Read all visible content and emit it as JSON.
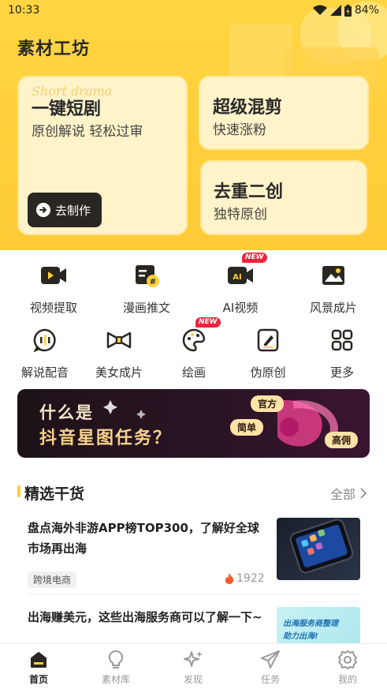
{
  "status": {
    "time": "10:33",
    "battery": "84%"
  },
  "header": {
    "title": "素材工坊"
  },
  "cards": {
    "big": {
      "title": "一键短剧",
      "subtitle": "原创解说 轻松过审",
      "watermark": "Short drama",
      "button": "去制作"
    },
    "small1": {
      "title": "超级混剪",
      "subtitle": "快速涨粉"
    },
    "small2": {
      "title": "去重二创",
      "subtitle": "独特原创"
    }
  },
  "features": [
    {
      "label": "视频提取",
      "icon": "video-camera-icon",
      "badge": ""
    },
    {
      "label": "漫画推文",
      "icon": "comic-icon",
      "badge": ""
    },
    {
      "label": "AI视频",
      "icon": "ai-video-icon",
      "badge": "NEW"
    },
    {
      "label": "风景成片",
      "icon": "landscape-image-icon",
      "badge": ""
    },
    {
      "label": "解说配音",
      "icon": "voice-dub-icon",
      "badge": ""
    },
    {
      "label": "美女成片",
      "icon": "bow-icon",
      "badge": ""
    },
    {
      "label": "绘画",
      "icon": "palette-icon",
      "badge": "NEW"
    },
    {
      "label": "伪原创",
      "icon": "edit-pen-icon",
      "badge": ""
    },
    {
      "label": "更多",
      "icon": "grid-more-icon",
      "badge": ""
    }
  ],
  "banner": {
    "line1": "什么是",
    "line2": "抖音星图任务？",
    "tags": [
      "官方",
      "简单",
      "高佣"
    ]
  },
  "section": {
    "title": "精选干货",
    "all": "全部"
  },
  "articles": [
    {
      "title": "盘点海外非游APP榜TOP300，了解好全球市场再出海",
      "tag": "跨境电商",
      "views": "1922"
    },
    {
      "title": "出海赚美元，这些出海服务商可以了解一下~",
      "thumb_text1": "出海服务商整理",
      "thumb_text2": "助力出海!"
    }
  ],
  "nav": [
    {
      "label": "首页",
      "icon": "home-icon",
      "active": true
    },
    {
      "label": "素材库",
      "icon": "lightbulb-icon",
      "active": false
    },
    {
      "label": "发现",
      "icon": "sparkle-icon",
      "active": false
    },
    {
      "label": "任务",
      "icon": "paper-plane-icon",
      "active": false
    },
    {
      "label": "我的",
      "icon": "settings-gear-icon",
      "active": false
    }
  ],
  "colors": {
    "accent": "#ffcf3c",
    "badge": "#f0243d",
    "dark": "#2a2722"
  }
}
